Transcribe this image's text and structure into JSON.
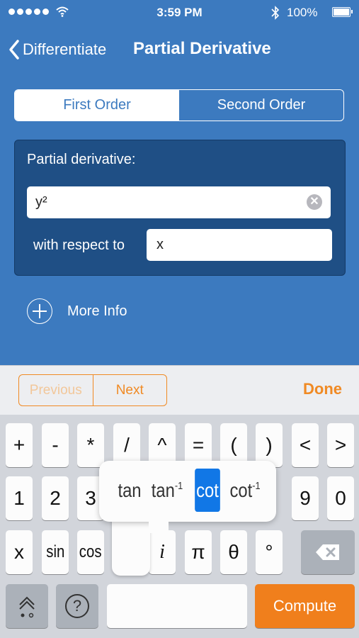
{
  "status_bar": {
    "time": "3:59 PM",
    "battery": "100%"
  },
  "nav": {
    "back_label": "Differentiate",
    "title": "Partial Derivative"
  },
  "segmented": {
    "first": "First Order",
    "second": "Second Order",
    "selected": "First Order"
  },
  "panel": {
    "title": "Partial derivative:",
    "expression_value": "y²",
    "respect_label": "with respect to",
    "variable_value": "x"
  },
  "more_info": {
    "label": "More Info"
  },
  "toolbar": {
    "previous": "Previous",
    "next": "Next",
    "done": "Done"
  },
  "keyboard": {
    "row1": [
      "+",
      "-",
      "*",
      "/",
      "^",
      "=",
      "(",
      ")",
      "<",
      ">"
    ],
    "row2": [
      "1",
      "2",
      "3",
      "9",
      "0"
    ],
    "row3": [
      "x",
      "sin",
      "cos",
      "i",
      "π",
      "θ",
      "°"
    ],
    "compute": "Compute",
    "help": "?"
  },
  "popup": {
    "items": [
      "tan",
      "tan",
      "cot",
      "cot"
    ],
    "superscripts": [
      "-1",
      "-1"
    ],
    "selected": "cot"
  },
  "colors": {
    "background": "#3c7abf",
    "panel": "#1f4f85",
    "accent": "#f07f1c",
    "selection": "#1177e6"
  }
}
